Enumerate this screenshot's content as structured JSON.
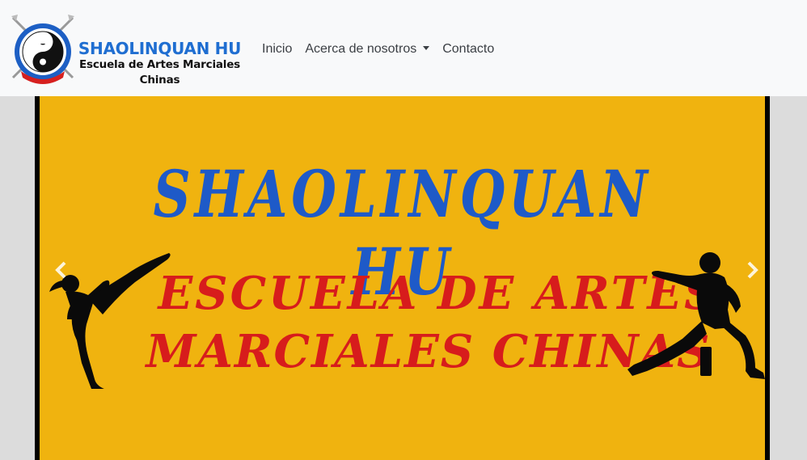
{
  "brand": {
    "title": "SHAOLINQUAN HU",
    "subtitle_line1": "Escuela de Artes Marciales",
    "subtitle_line2": "Chinas",
    "logo_icon": "yin-yang-logo-icon"
  },
  "nav": {
    "items": [
      {
        "label": "Inicio"
      },
      {
        "label": "Acerca de nosotros",
        "dropdown": true
      },
      {
        "label": "Contacto"
      }
    ]
  },
  "carousel": {
    "slide": {
      "title": "SHAOLINQUAN HU",
      "subtitle_line1": "ESCUELA  DE  ARTES",
      "subtitle_line2": "MARCIALES CHINAS",
      "background": "#f0b30f",
      "title_color": "#1e5ac8",
      "subtitle_color": "#d71c1c"
    },
    "prev_icon": "chevron-left-icon",
    "next_icon": "chevron-right-icon"
  },
  "colors": {
    "brand_blue": "#1f6ed1",
    "navbar_bg": "#f8f9fa"
  }
}
